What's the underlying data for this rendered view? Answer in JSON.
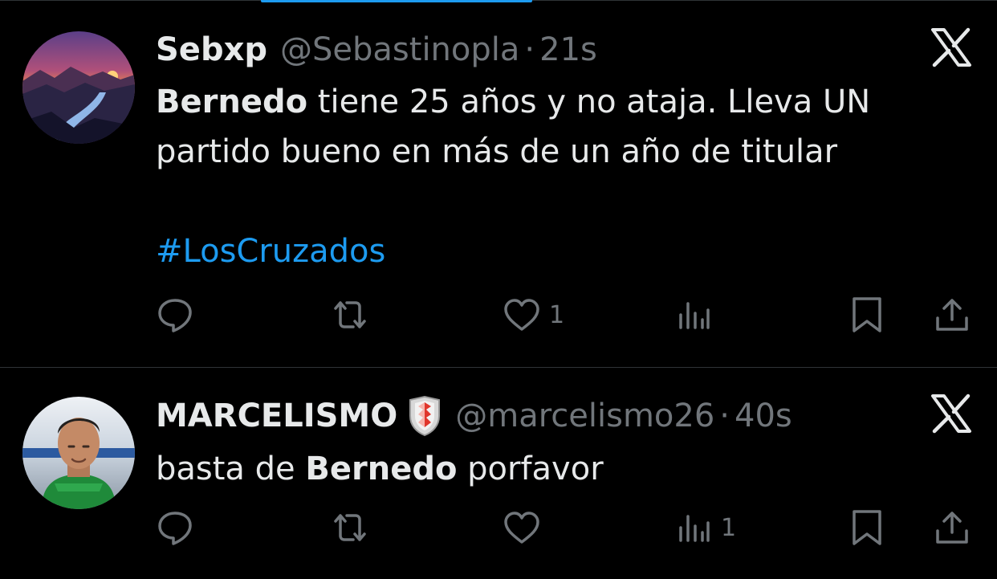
{
  "tweets": [
    {
      "display_name": "Sebxp",
      "handle": "@Sebastinopla",
      "separator": "·",
      "time": "21s",
      "text_line1_bold": "Bernedo",
      "text_line1_rest": " tiene 25 años y no ataja. Lleva UN",
      "text_line2": "partido bueno en más de un año de titular",
      "hashtag": "#LosCruzados",
      "counts": {
        "reply": "",
        "retweet": "",
        "like": "1",
        "views": "",
        "bookmark": "",
        "share": ""
      },
      "avatar_icon": "sunset-landscape-avatar",
      "menu_icon": "x-logo-icon"
    },
    {
      "display_name": "MARCELISMO",
      "handle": "@marcelismo26",
      "separator": "·",
      "time": "40s",
      "text_prefix": "basta de ",
      "text_bold": "Bernedo",
      "text_suffix": " porfavor",
      "counts": {
        "reply": "",
        "retweet": "",
        "like": "",
        "views": "1",
        "bookmark": "",
        "share": ""
      },
      "avatar_icon": "footballer-avatar",
      "badge_icon": "club-crest-badge",
      "menu_icon": "x-logo-icon"
    }
  ],
  "colors": {
    "background": "#000000",
    "text": "#e7e9ea",
    "secondary": "#71767b",
    "accent": "#1d9bf0",
    "divider": "#2f3336"
  }
}
